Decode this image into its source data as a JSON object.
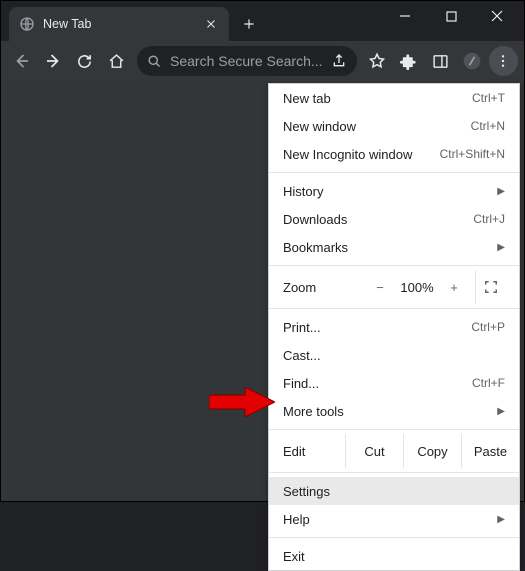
{
  "tab": {
    "title": "New Tab"
  },
  "omnibox": {
    "placeholder": "Search Secure Search..."
  },
  "menu": {
    "new_tab": {
      "label": "New tab",
      "shortcut": "Ctrl+T"
    },
    "new_window": {
      "label": "New window",
      "shortcut": "Ctrl+N"
    },
    "incognito": {
      "label": "New Incognito window",
      "shortcut": "Ctrl+Shift+N"
    },
    "history": {
      "label": "History"
    },
    "downloads": {
      "label": "Downloads",
      "shortcut": "Ctrl+J"
    },
    "bookmarks": {
      "label": "Bookmarks"
    },
    "zoom": {
      "label": "Zoom",
      "minus": "−",
      "pct": "100%",
      "plus": "+"
    },
    "print": {
      "label": "Print...",
      "shortcut": "Ctrl+P"
    },
    "cast": {
      "label": "Cast..."
    },
    "find": {
      "label": "Find...",
      "shortcut": "Ctrl+F"
    },
    "more_tools": {
      "label": "More tools"
    },
    "edit": {
      "label": "Edit",
      "cut": "Cut",
      "copy": "Copy",
      "paste": "Paste"
    },
    "settings": {
      "label": "Settings"
    },
    "help": {
      "label": "Help"
    },
    "exit": {
      "label": "Exit"
    }
  }
}
